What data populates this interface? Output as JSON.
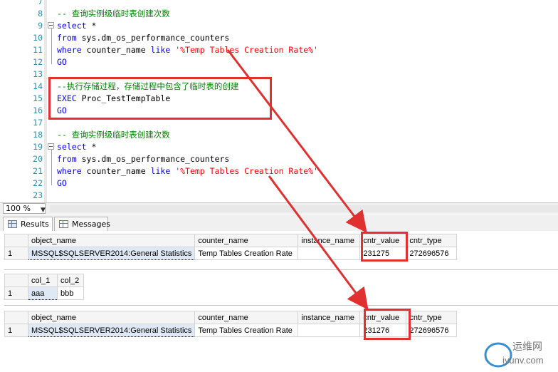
{
  "editor": {
    "lines": [
      {
        "num": "7",
        "segments": []
      },
      {
        "num": "8",
        "segments": [
          {
            "t": "-- 查询实例级临时表创建次数",
            "c": "cm"
          }
        ]
      },
      {
        "num": "9",
        "segments": [
          {
            "t": "select",
            "c": "kw"
          },
          {
            "t": " *",
            "c": ""
          }
        ]
      },
      {
        "num": "10",
        "segments": [
          {
            "t": "from",
            "c": "kw"
          },
          {
            "t": " sys.dm_os_performance_counters",
            "c": ""
          }
        ]
      },
      {
        "num": "11",
        "segments": [
          {
            "t": "where",
            "c": "kw"
          },
          {
            "t": " counter_name ",
            "c": ""
          },
          {
            "t": "like",
            "c": "kw"
          },
          {
            "t": " '%Temp Tables Creation Rate%'",
            "c": "str"
          }
        ]
      },
      {
        "num": "12",
        "segments": [
          {
            "t": "GO",
            "c": "kw"
          }
        ]
      },
      {
        "num": "13",
        "segments": []
      },
      {
        "num": "14",
        "segments": [
          {
            "t": "--执行存储过程，存储过程中包含了临时表的创建",
            "c": "cm"
          }
        ]
      },
      {
        "num": "15",
        "segments": [
          {
            "t": "EXEC",
            "c": "kw"
          },
          {
            "t": " Proc_TestTempTable",
            "c": ""
          }
        ]
      },
      {
        "num": "16",
        "segments": [
          {
            "t": "GO",
            "c": "kw"
          }
        ]
      },
      {
        "num": "17",
        "segments": []
      },
      {
        "num": "18",
        "segments": [
          {
            "t": "-- 查询实例级临时表创建次数",
            "c": "cm"
          }
        ]
      },
      {
        "num": "19",
        "segments": [
          {
            "t": "select",
            "c": "kw"
          },
          {
            "t": " *",
            "c": ""
          }
        ]
      },
      {
        "num": "20",
        "segments": [
          {
            "t": "from",
            "c": "kw"
          },
          {
            "t": " sys.dm_os_performance_counters",
            "c": ""
          }
        ]
      },
      {
        "num": "21",
        "segments": [
          {
            "t": "where",
            "c": "kw"
          },
          {
            "t": " counter_name ",
            "c": ""
          },
          {
            "t": "like",
            "c": "kw"
          },
          {
            "t": " '%Temp Tables Creation Rate%'",
            "c": "str"
          }
        ]
      },
      {
        "num": "22",
        "segments": [
          {
            "t": "GO",
            "c": "kw"
          }
        ]
      },
      {
        "num": "23",
        "segments": []
      }
    ]
  },
  "zoom": {
    "value": "100 %"
  },
  "tabs": {
    "results": "Results",
    "messages": "Messages"
  },
  "grid1": {
    "headers": [
      "object_name",
      "counter_name",
      "instance_name",
      "cntr_value",
      "cntr_type"
    ],
    "rows": [
      [
        "1",
        "MSSQL$SQLSERVER2014:General Statistics",
        "Temp Tables Creation Rate",
        "",
        "231275",
        "272696576"
      ]
    ]
  },
  "grid2": {
    "headers": [
      "col_1",
      "col_2"
    ],
    "rows": [
      [
        "1",
        "aaa",
        "bbb"
      ]
    ]
  },
  "grid3": {
    "headers": [
      "object_name",
      "counter_name",
      "instance_name",
      "cntr_value",
      "cntr_type"
    ],
    "rows": [
      [
        "1",
        "MSSQL$SQLSERVER2014:General Statistics",
        "Temp Tables Creation Rate",
        "",
        "231276",
        "272696576"
      ]
    ]
  },
  "watermark": {
    "line1": "运维网",
    "line2": "iyunv.com"
  },
  "colors": {
    "annotation": "#e03030",
    "keyword": "#0000ff",
    "comment": "#008000",
    "string": "#ff0000"
  }
}
